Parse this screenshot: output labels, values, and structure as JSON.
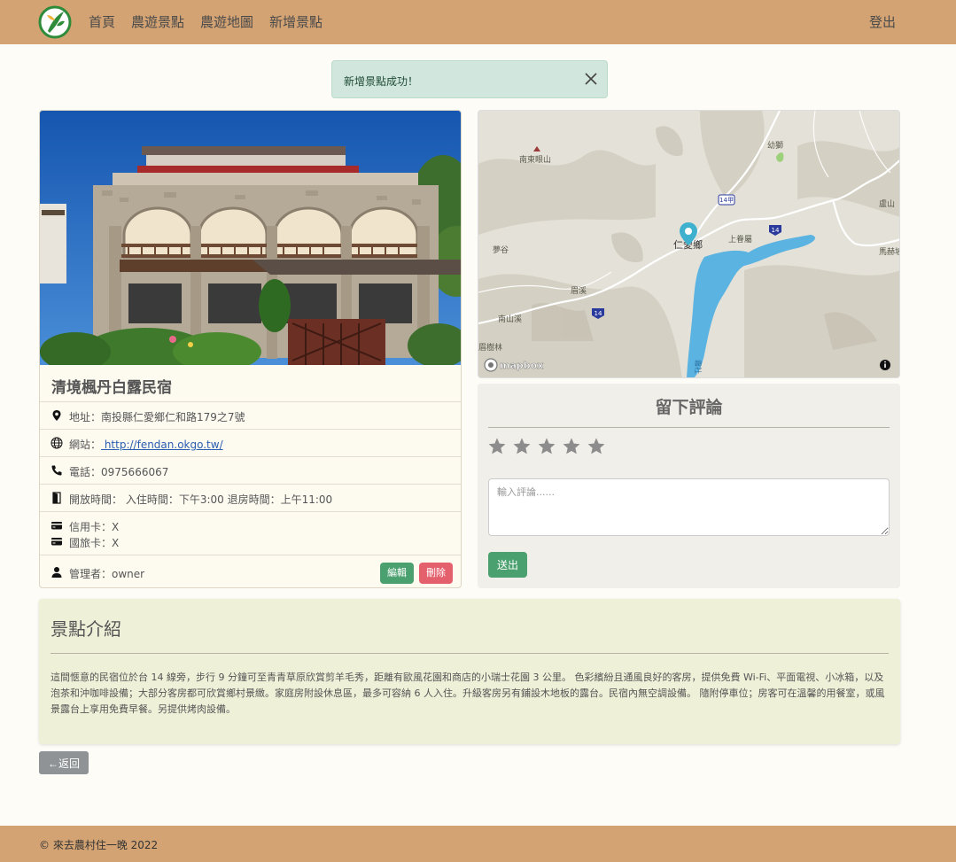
{
  "nav": {
    "links": [
      "首頁",
      "農遊景點",
      "農遊地圖",
      "新增景點"
    ],
    "logout": "登出"
  },
  "alert": {
    "message": "新增景點成功！"
  },
  "spot": {
    "name": "清境楓丹白露民宿",
    "address_label": "地址：",
    "address": "南投縣仁愛鄉仁和路179之7號",
    "website_label": "網站：",
    "website": " http://fendan.okgo.tw/",
    "phone_label": "電話：",
    "phone": "0975666067",
    "hours_label": "開放時間：",
    "hours": "入住時間：下午3:00 退房時間：上午11:00",
    "credit_label": "信用卡：",
    "credit": "X",
    "travel_label": "國旅卡：",
    "travel": "X",
    "manager_label": "管理者：",
    "manager": "owner",
    "edit_label": "編輯",
    "delete_label": "刪除"
  },
  "map": {
    "labels": [
      "南東眼山",
      "幼獅",
      "仁愛鄉",
      "上眷屬",
      "夢谷",
      "眉溪",
      "南山溪",
      "眉樹林",
      "盧山",
      "馬赫坡",
      "霧社"
    ],
    "route_numbers": [
      "14甲",
      "14",
      "14"
    ],
    "attribution": "mapbox",
    "pin_color": "#3fb1ce"
  },
  "review": {
    "title": "留下評論",
    "rating": 0,
    "max_rating": 5,
    "placeholder": "輸入評論......",
    "submit_label": "送出"
  },
  "intro": {
    "title": "景點介紹",
    "body": "這間愜意的民宿位於台 14 線旁，步行 9 分鐘可至青青草原欣賞剪羊毛秀，距離有歐風花園和商店的小瑞士花園 3 公里。 色彩繽紛且通風良好的客房，提供免費 Wi-Fi、平面電視、小冰箱，以及泡茶和沖咖啡設備；大部分客房都可欣賞鄉村景緻。家庭房附設休息區，最多可容納 6 人入住。升級客房另有鋪設木地板的露台。民宿內無空調設備。 隨附停車位；房客可在溫馨的用餐室，或風景露台上享用免費早餐。另提供烤肉設備。"
  },
  "back_label": "←返回",
  "footer": {
    "text": "© 來去農村住一晚 2022"
  },
  "colors": {
    "nav_bg": "#d4a373",
    "alert_bg": "#d1e7dd",
    "edit_btn": "#4aa06e",
    "delete_btn": "#e4606d",
    "submit_btn": "#4aa06e",
    "back_btn": "#8f9396",
    "intro_bg": "#eef0d8"
  }
}
